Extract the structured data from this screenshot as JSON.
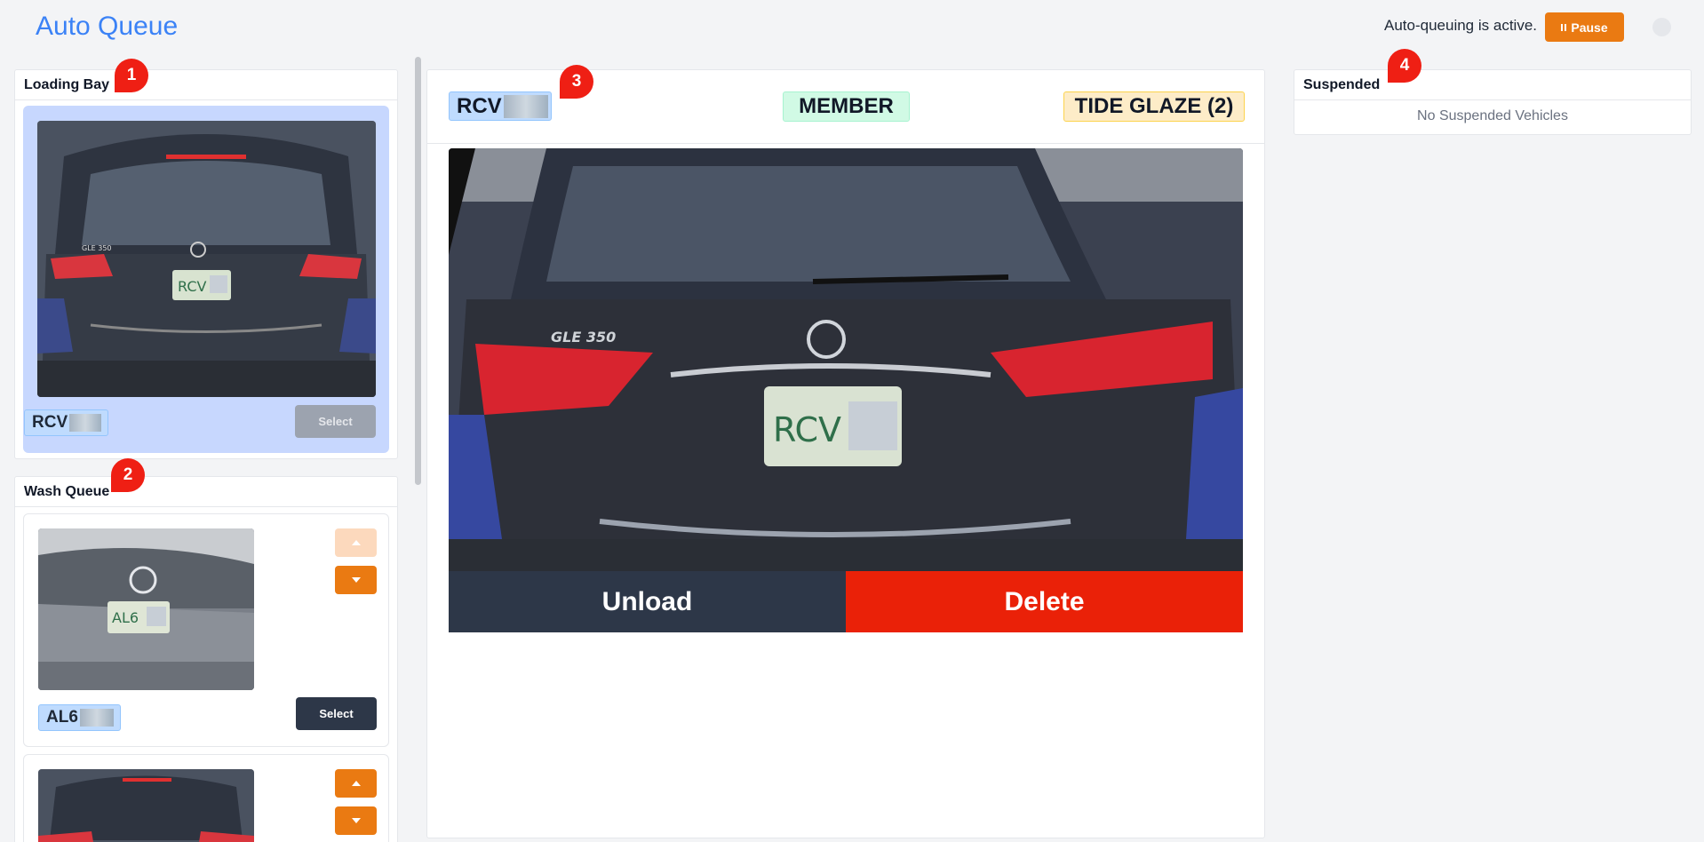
{
  "header": {
    "title": "Auto Queue",
    "status": "Auto-queuing is active.",
    "pause_label": "Pause"
  },
  "loading_bay": {
    "title": "Loading Bay",
    "vehicle": {
      "plate": "RCV",
      "select_label": "Select"
    }
  },
  "wash_queue": {
    "title": "Wash Queue",
    "items": [
      {
        "plate": "AL6",
        "select_label": "Select"
      },
      {
        "plate": ""
      }
    ]
  },
  "current": {
    "plate": "RCV",
    "member_badge": "MEMBER",
    "service_badge": "TIDE GLAZE (2)",
    "unload_label": "Unload",
    "delete_label": "Delete",
    "photo_text": {
      "model": "GLE 350",
      "plate": "RCV"
    }
  },
  "suspended": {
    "title": "Suspended",
    "empty_text": "No Suspended Vehicles"
  },
  "markers": [
    "1",
    "2",
    "3",
    "4"
  ],
  "colors": {
    "accent": "#3b82f6",
    "orange": "#ea7a12",
    "danger": "#ea2108",
    "dark": "#2d3748",
    "plate_bg": "#bfdbfe",
    "member_bg": "#d1fae5",
    "service_bg": "#fdecc8",
    "marker": "#ef1f14"
  }
}
